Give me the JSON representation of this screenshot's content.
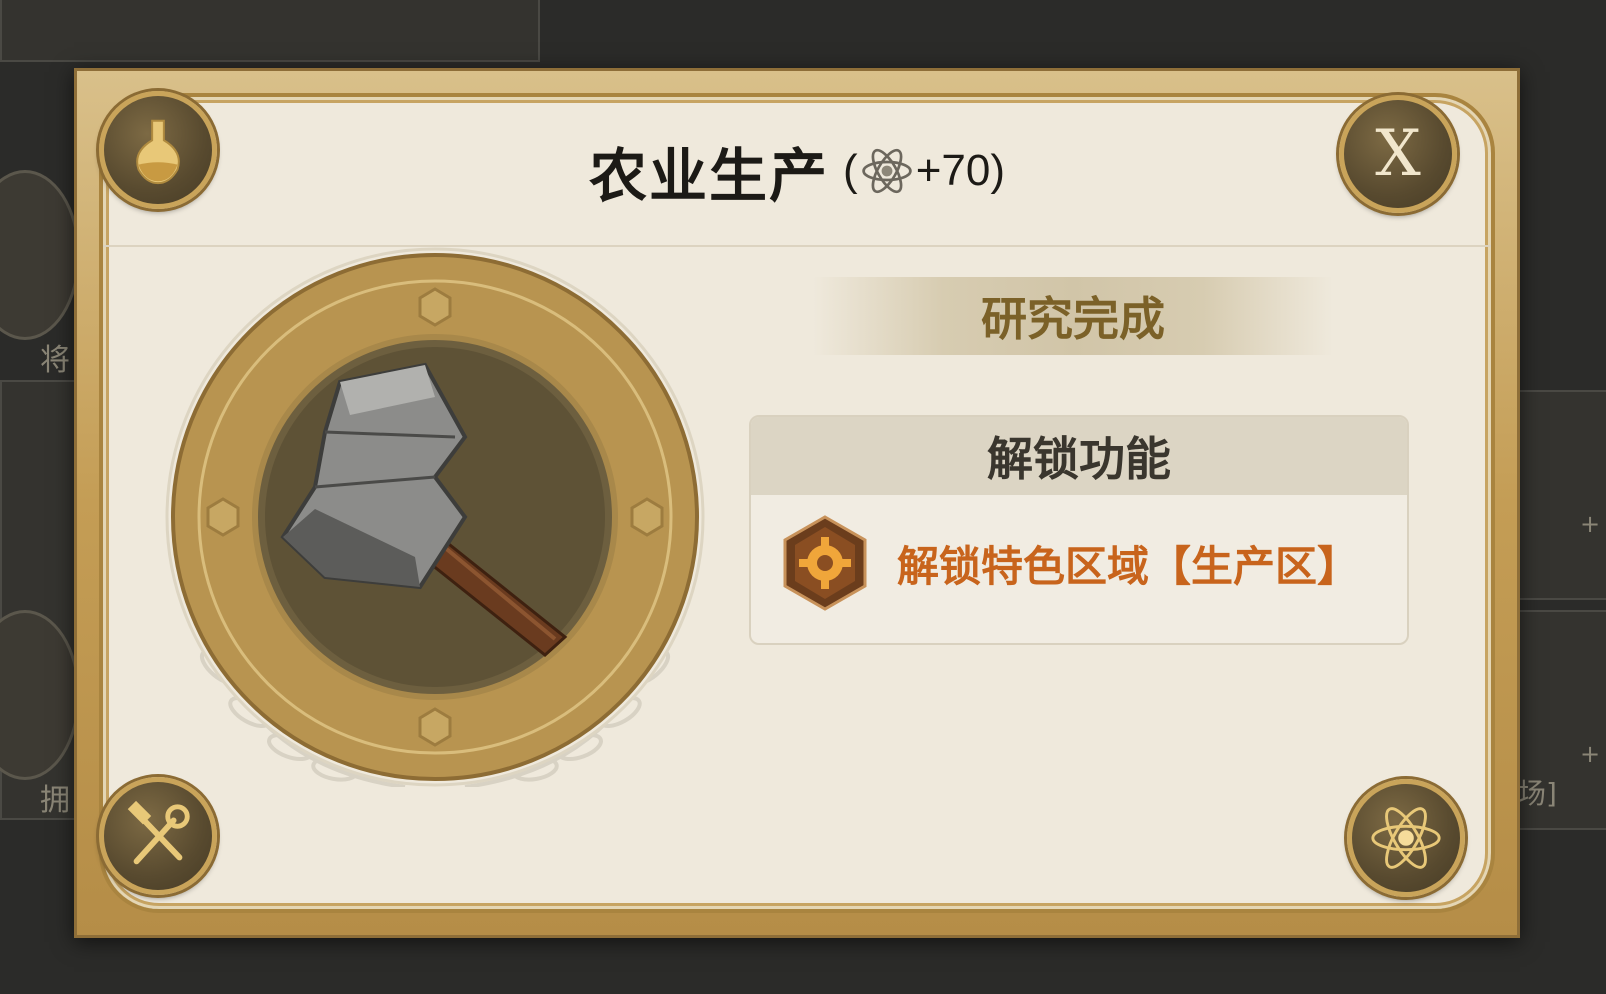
{
  "dialog": {
    "title": "农业生产",
    "reward_open": "(",
    "reward_icon": "atom-icon",
    "reward_value": "+70",
    "reward_close": ")",
    "close_label": "X",
    "status": "研究完成",
    "unlock_header": "解锁功能",
    "unlock_item": "解锁特色区域【生产区】",
    "emblem_icon": "hammer-icon",
    "corner_icons": [
      "flask-icon",
      "close-icon",
      "tools-icon",
      "atom-icon"
    ]
  },
  "background": {
    "left_label_1": "将",
    "left_label_2": "拥",
    "right_label": "矿场]",
    "right_mark": "+"
  },
  "colors": {
    "frame_gold": "#c49d55",
    "panel_bg": "#efe9dc",
    "status_text": "#7b6128",
    "unlock_text": "#c8641c"
  }
}
